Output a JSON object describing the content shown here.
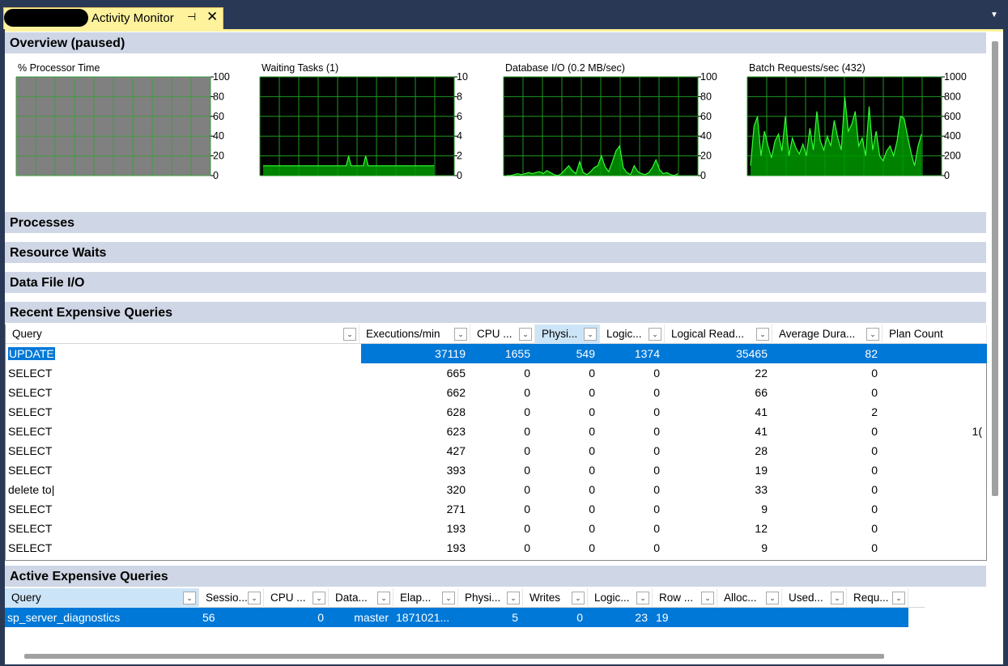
{
  "tab": {
    "title": "Activity Monitor",
    "pin_icon": "pin-icon",
    "close_icon": "close-icon"
  },
  "sections": {
    "overview": "Overview (paused)",
    "processes": "Processes",
    "resource_waits": "Resource Waits",
    "data_file_io": "Data File I/O",
    "recent": "Recent Expensive Queries",
    "active": "Active Expensive Queries"
  },
  "charts": {
    "processor": {
      "title": "% Processor Time",
      "ticks": [
        "100",
        "80",
        "60",
        "40",
        "20",
        "0"
      ]
    },
    "waiting": {
      "title": "Waiting Tasks (1)",
      "ticks": [
        "10",
        "8",
        "6",
        "4",
        "2",
        "0"
      ]
    },
    "dbio": {
      "title": "Database I/O (0.2 MB/sec)",
      "ticks": [
        "100",
        "80",
        "60",
        "40",
        "20",
        "0"
      ]
    },
    "batch": {
      "title": "Batch Requests/sec (432)",
      "ticks": [
        "1000",
        "800",
        "600",
        "400",
        "200",
        "0"
      ]
    }
  },
  "chart_data": [
    {
      "type": "area",
      "title": "% Processor Time",
      "ylim": [
        0,
        100
      ],
      "values": [],
      "background": "#808080"
    },
    {
      "type": "area",
      "title": "Waiting Tasks (1)",
      "ylim": [
        0,
        10
      ],
      "values": [
        1,
        1,
        1,
        1,
        1,
        1,
        1,
        1,
        1,
        1,
        1,
        1,
        1,
        1,
        1,
        1,
        1,
        1,
        1,
        1,
        1,
        1,
        1,
        1,
        1,
        1,
        1,
        1,
        1,
        1,
        1,
        1,
        1,
        1,
        1,
        2,
        1,
        1,
        1,
        1,
        1,
        1,
        2,
        1,
        1,
        1,
        1,
        1,
        1,
        1,
        1,
        1,
        1,
        1,
        1,
        1,
        1,
        1,
        1,
        1,
        1,
        1,
        1,
        1,
        1,
        1,
        1,
        1,
        1,
        1,
        1
      ],
      "color": "#00b300"
    },
    {
      "type": "area",
      "title": "Database I/O (0.2 MB/sec)",
      "ylim": [
        0,
        100
      ],
      "values": [
        0,
        0,
        1,
        2,
        1,
        2,
        3,
        2,
        3,
        4,
        2,
        5,
        3,
        1,
        0,
        2,
        6,
        10,
        5,
        2,
        14,
        3,
        1,
        4,
        8,
        10,
        20,
        9,
        4,
        14,
        25,
        30,
        8,
        3,
        1,
        10,
        4,
        2,
        1,
        3,
        8,
        16,
        6,
        2,
        3,
        1,
        0,
        2
      ],
      "color": "#00b300"
    },
    {
      "type": "area",
      "title": "Batch Requests/sec (432)",
      "ylim": [
        0,
        1000
      ],
      "values": [
        100,
        500,
        600,
        200,
        450,
        300,
        180,
        350,
        420,
        250,
        600,
        200,
        380,
        280,
        220,
        320,
        200,
        480,
        260,
        650,
        350,
        260,
        400,
        300,
        560,
        380,
        260,
        800,
        450,
        520,
        650,
        300,
        380,
        200,
        700,
        260,
        450,
        200,
        150,
        250,
        300,
        200,
        350,
        600,
        580,
        400,
        230,
        100,
        300,
        420
      ],
      "color": "#00b300"
    }
  ],
  "recent": {
    "columns": [
      "Query",
      "Executions/min",
      "CPU ...",
      "Physi...",
      "Logic...",
      "Logical Read...",
      "Average Dura...",
      "Plan Count"
    ],
    "rows": [
      [
        "UPDATE",
        "37119",
        "1655",
        "549",
        "1374",
        "35465",
        "82",
        ""
      ],
      [
        "SELECT",
        "665",
        "0",
        "0",
        "0",
        "22",
        "0",
        ""
      ],
      [
        "SELECT",
        "662",
        "0",
        "0",
        "0",
        "66",
        "0",
        ""
      ],
      [
        "SELECT",
        "628",
        "0",
        "0",
        "0",
        "41",
        "2",
        ""
      ],
      [
        "SELECT",
        "623",
        "0",
        "0",
        "0",
        "41",
        "0",
        "1("
      ],
      [
        "SELECT",
        "427",
        "0",
        "0",
        "0",
        "28",
        "0",
        ""
      ],
      [
        "SELECT",
        "393",
        "0",
        "0",
        "0",
        "19",
        "0",
        ""
      ],
      [
        "delete to|",
        "320",
        "0",
        "0",
        "0",
        "33",
        "0",
        ""
      ],
      [
        "SELECT",
        "271",
        "0",
        "0",
        "0",
        "9",
        "0",
        ""
      ],
      [
        "SELECT",
        "193",
        "0",
        "0",
        "0",
        "12",
        "0",
        ""
      ],
      [
        "SELECT",
        "193",
        "0",
        "0",
        "0",
        "9",
        "0",
        ""
      ]
    ]
  },
  "active": {
    "columns": [
      "Query",
      "Sessio...",
      "CPU ...",
      "Data...",
      "Elap...",
      "Physi...",
      "Writes",
      "Logic...",
      "Row ...",
      "Alloc...",
      "Used...",
      "Requ..."
    ],
    "rows": [
      [
        "sp_server_diagnostics",
        "56",
        "0",
        "master",
        "1871021...",
        "5",
        "0",
        "23",
        "19",
        "",
        "",
        ""
      ]
    ]
  }
}
